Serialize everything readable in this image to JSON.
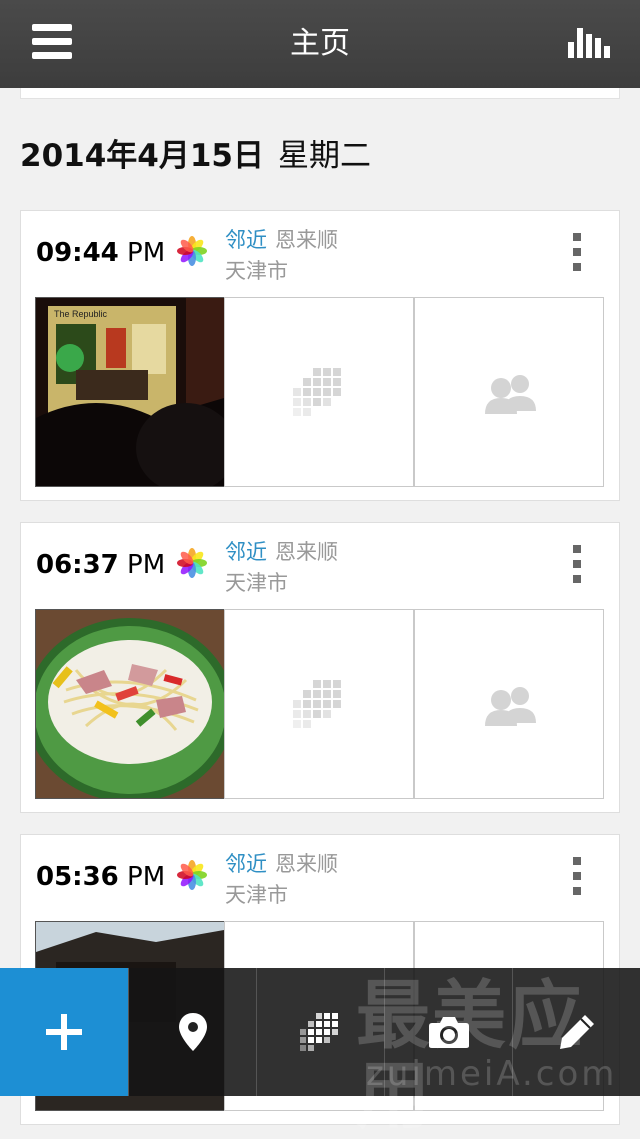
{
  "header": {
    "title": "主页"
  },
  "date": {
    "date": "2014年4月15日",
    "weekday": "星期二"
  },
  "entries": [
    {
      "time": "09:44",
      "ampm": "PM",
      "tag": "邻近",
      "place": "恩来顺",
      "city": "天津市",
      "photo": "live-music-bar"
    },
    {
      "time": "06:37",
      "ampm": "PM",
      "tag": "邻近",
      "place": "恩来顺",
      "city": "天津市",
      "photo": "pasta-dish"
    },
    {
      "time": "05:36",
      "ampm": "PM",
      "tag": "邻近",
      "place": "恩来顺",
      "city": "天津市",
      "photo": "table-scene"
    }
  ],
  "toolbar": {
    "items": [
      "add-icon",
      "location-pin-icon",
      "grid-icon",
      "camera-icon",
      "pencil-icon"
    ],
    "accent": "#1d8fd4"
  },
  "watermark": {
    "title": "最美应用",
    "url": "zuimeiA.com"
  },
  "colors": {
    "link": "#2f8fc4",
    "topbar": "#444444",
    "background": "#f1f1f1"
  }
}
